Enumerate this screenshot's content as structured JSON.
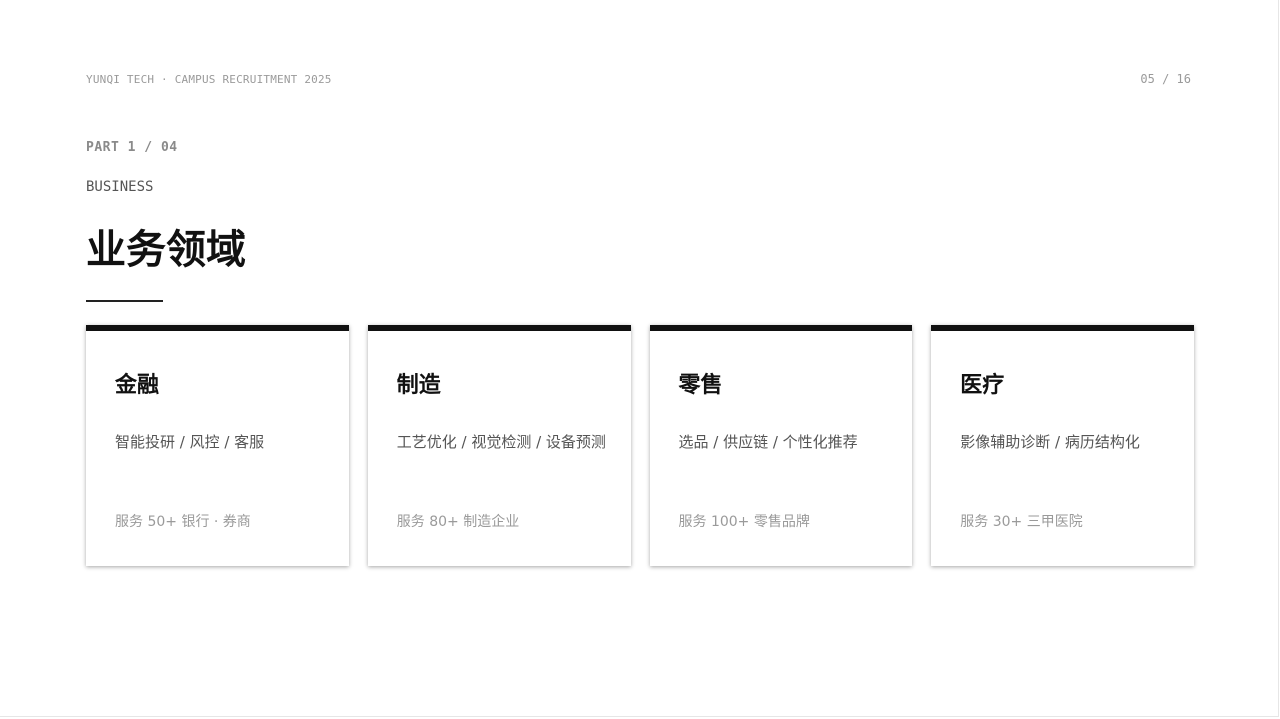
{
  "header": {
    "brand": "YUNQI TECH · CAMPUS RECRUITMENT 2025",
    "page_indicator": "05 / 16"
  },
  "section": {
    "part": "PART 1 / 04",
    "eyebrow": "BUSINESS",
    "title": "业务领域"
  },
  "cards": [
    {
      "title": "金融",
      "desc": "智能投研 / 风控 / 客服",
      "stat": "服务 50+ 银行 · 券商"
    },
    {
      "title": "制造",
      "desc": "工艺优化 / 视觉检测 / 设备预测",
      "stat": "服务 80+ 制造企业"
    },
    {
      "title": "零售",
      "desc": "选品 / 供应链 / 个性化推荐",
      "stat": "服务 100+ 零售品牌"
    },
    {
      "title": "医疗",
      "desc": "影像辅助诊断 / 病历结构化",
      "stat": "服务 30+ 三甲医院"
    }
  ]
}
